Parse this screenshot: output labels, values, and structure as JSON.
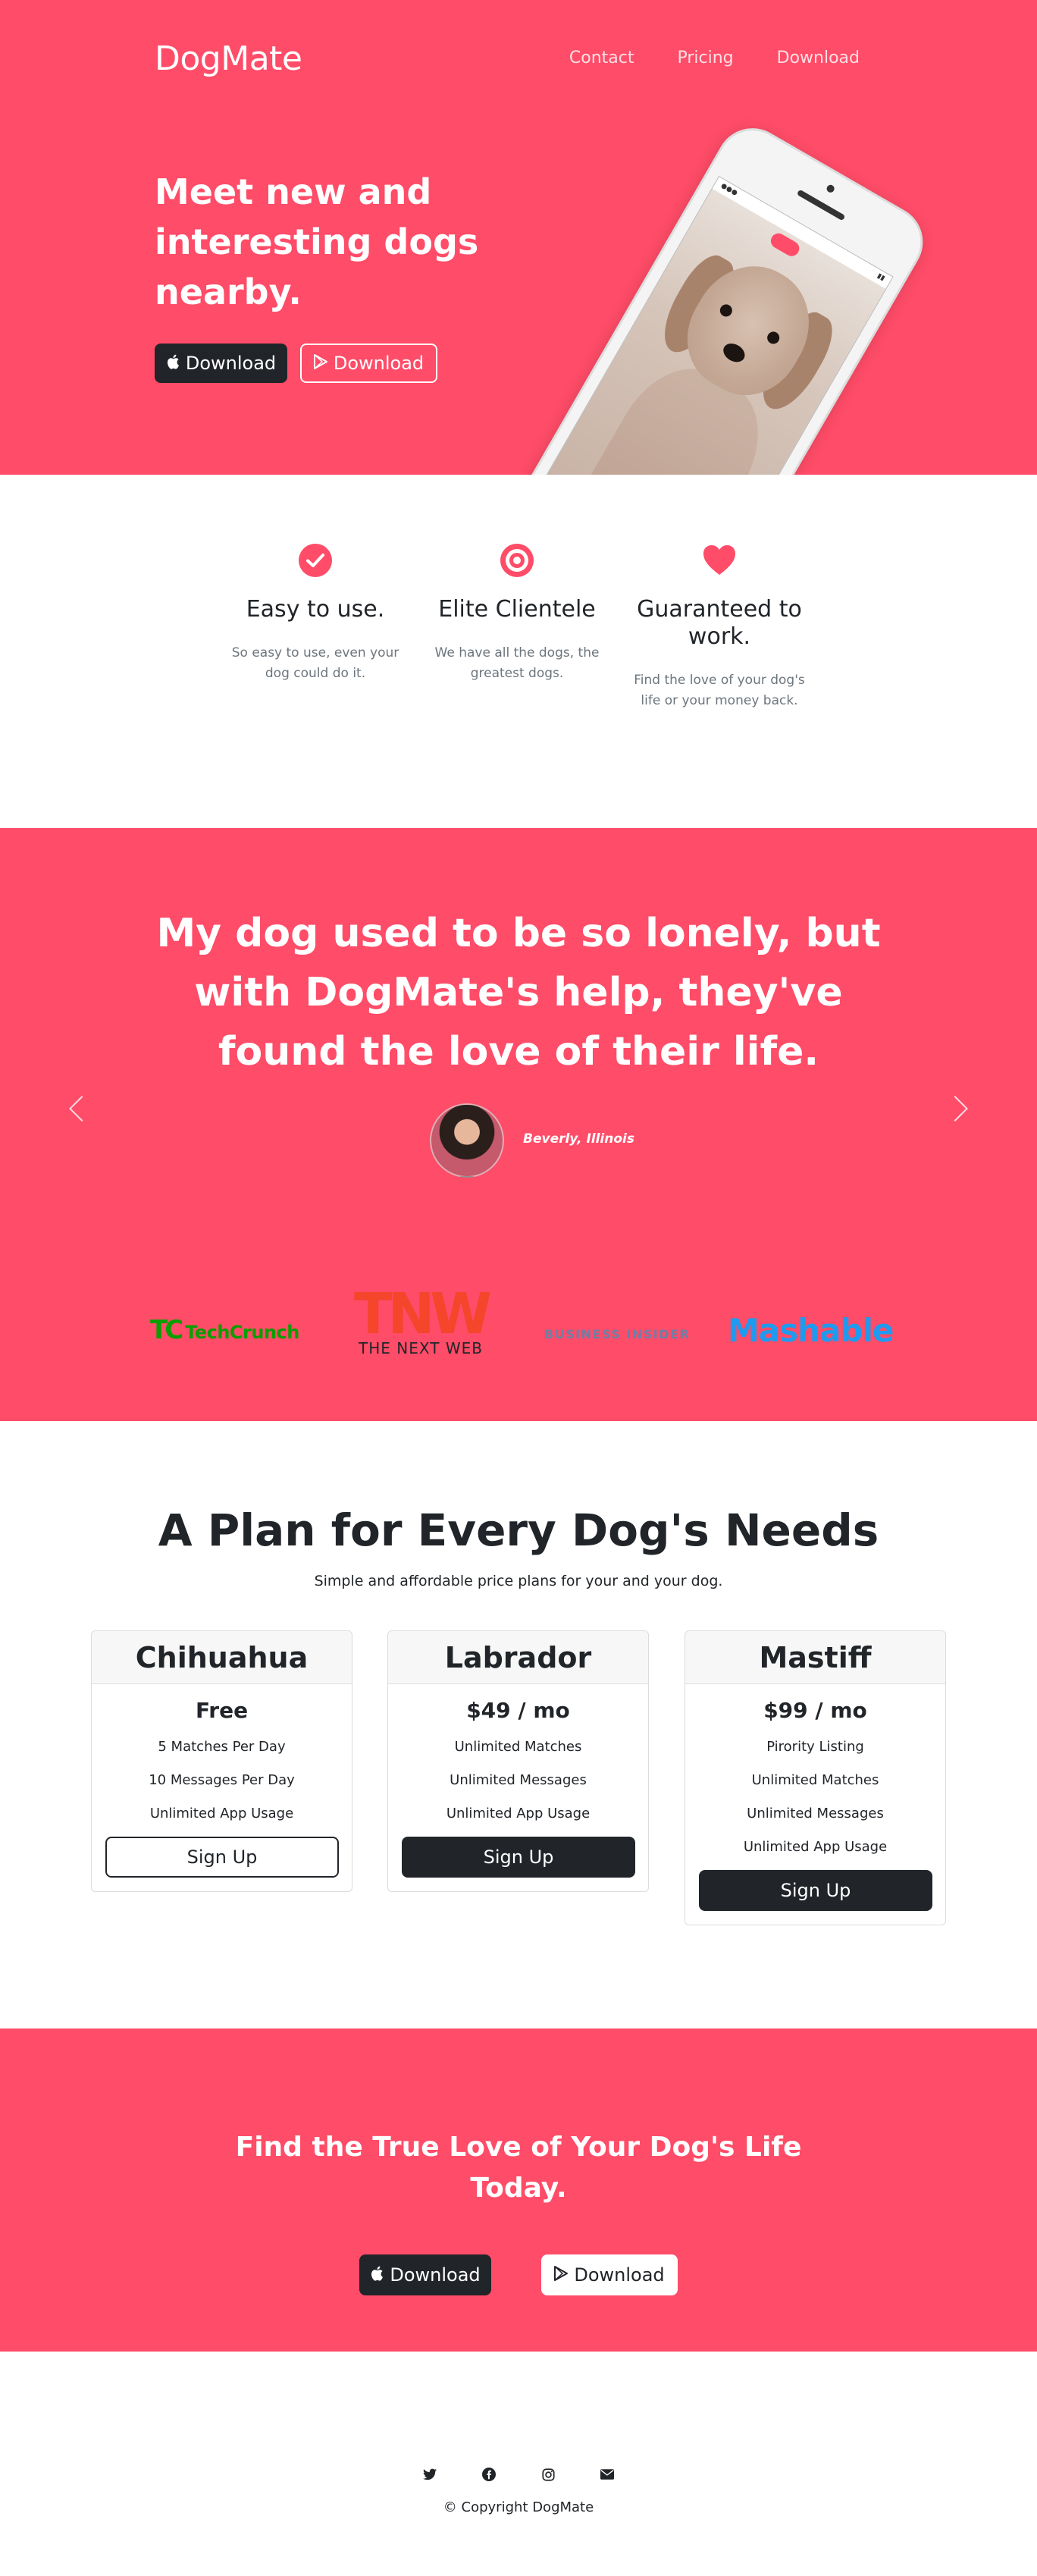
{
  "brand": "DogMate",
  "nav": {
    "contact": "Contact",
    "pricing": "Pricing",
    "download": "Download"
  },
  "hero": {
    "title": "Meet new and interesting dogs nearby.",
    "apple_label": "Download",
    "play_label": "Download"
  },
  "features": [
    {
      "icon": "checkmark-circle-icon",
      "title": "Easy to use.",
      "text": "So easy to use, even your dog could do it."
    },
    {
      "icon": "target-icon",
      "title": "Elite Clientele",
      "text": "We have all the dogs, the greatest dogs."
    },
    {
      "icon": "heart-icon",
      "title": "Guaranteed to work.",
      "text": "Find the love of your dog's life or your money back."
    }
  ],
  "testimonial": {
    "quote": "My dog used to be so lonely, but with DogMate's help, they've found the love of their life.",
    "author": "Beverly, Illinois"
  },
  "press_logos": {
    "techcrunch": "TechCrunch",
    "tnw_big": "TNW",
    "tnw_small": "THE NEXT WEB",
    "business_insider": "BUSINESS INSIDER",
    "mashable": "Mashable"
  },
  "pricing": {
    "title": "A Plan for Every Dog's Needs",
    "subtitle": "Simple and affordable price plans for your and your dog.",
    "plans": [
      {
        "name": "Chihuahua",
        "price": "Free",
        "features": [
          "5 Matches Per Day",
          "10 Messages Per Day",
          "Unlimited App Usage"
        ],
        "cta": "Sign Up"
      },
      {
        "name": "Labrador",
        "price": "$49 / mo",
        "features": [
          "Unlimited Matches",
          "Unlimited Messages",
          "Unlimited App Usage"
        ],
        "cta": "Sign Up"
      },
      {
        "name": "Mastiff",
        "price": "$99 / mo",
        "features": [
          "Pirority Listing",
          "Unlimited Matches",
          "Unlimited Messages",
          "Unlimited App Usage"
        ],
        "cta": "Sign Up"
      }
    ]
  },
  "cta": {
    "title": "Find the True Love of Your Dog's Life Today.",
    "apple_label": "Download",
    "play_label": "Download"
  },
  "footer": {
    "copyright": "© Copyright DogMate"
  },
  "colors": {
    "brand_pink": "#ff4c68",
    "dark": "#212529",
    "muted": "#6c757d"
  }
}
